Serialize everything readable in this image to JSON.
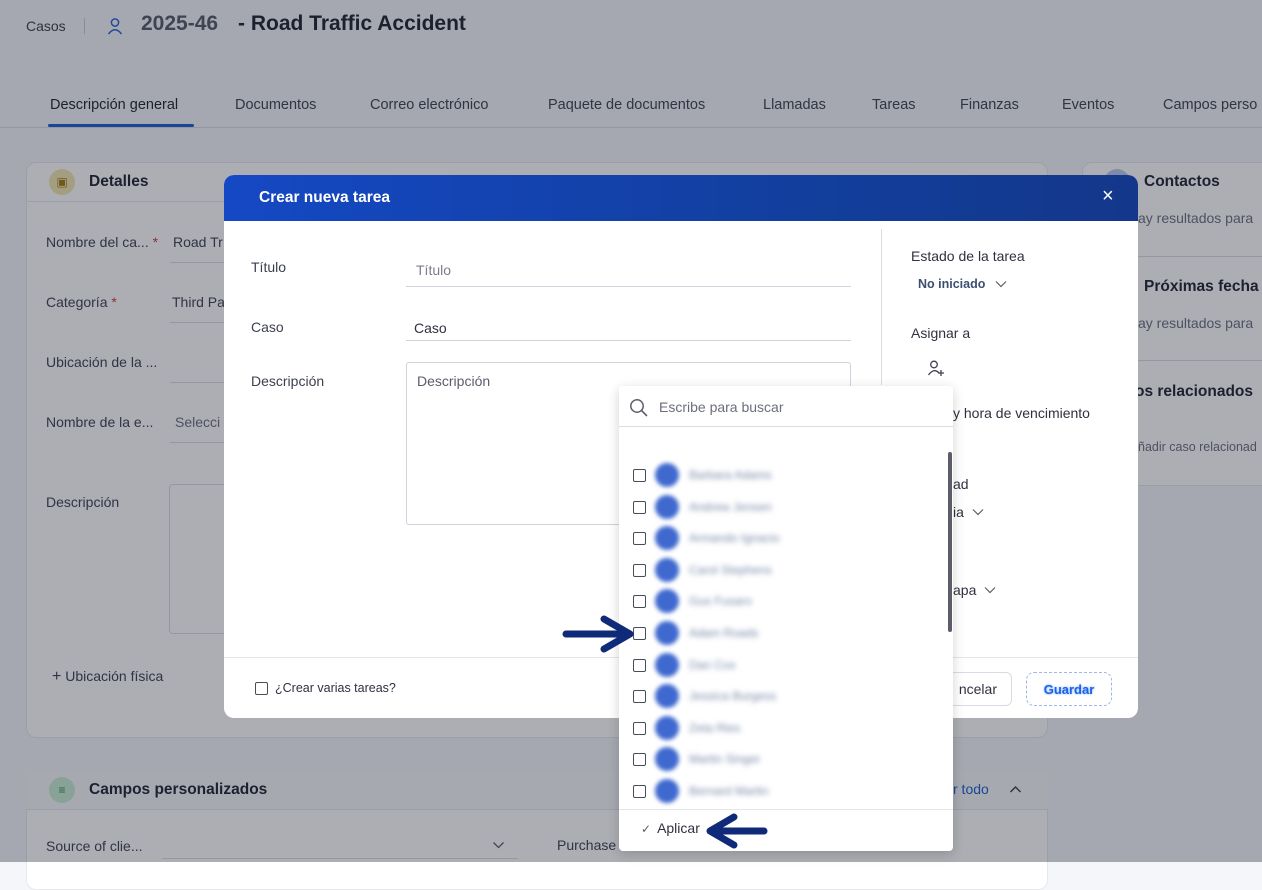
{
  "header": {
    "breadcrumb": "Casos",
    "case_number": "2025-46",
    "case_title": "- Road Traffic Accident"
  },
  "tabs": [
    {
      "label": "Descripción general",
      "active": true
    },
    {
      "label": "Documentos"
    },
    {
      "label": "Correo electrónico"
    },
    {
      "label": "Paquete de documentos"
    },
    {
      "label": "Llamadas"
    },
    {
      "label": "Tareas"
    },
    {
      "label": "Finanzas"
    },
    {
      "label": "Eventos"
    },
    {
      "label": "Campos perso"
    }
  ],
  "details": {
    "title": "Detalles",
    "fields": [
      {
        "label": "Nombre del ca...",
        "value": "Road Tr"
      },
      {
        "label": "Categoría",
        "value": "Third Pa"
      },
      {
        "label": "Ubicación de la ...",
        "value": ""
      },
      {
        "label": "Nombre de la e...",
        "value": "Selecci"
      },
      {
        "label": "Descripción",
        "value": ""
      }
    ],
    "physical_location": "Ubicación física"
  },
  "right_panel": {
    "contacts_title": "Contactos",
    "contacts_empty": "ay resultados para",
    "upcoming_title": "Próximas fecha",
    "upcoming_empty": "ay resultados para",
    "related_title": "os relacionados",
    "related_add": "ñadir caso relacionad"
  },
  "custom_fields": {
    "title": "Campos personalizados",
    "toggle_all": "r todo",
    "source_label": "Source of clie...",
    "purchase_label": "Purchase"
  },
  "modal": {
    "title": "Crear nueva tarea",
    "close": "×",
    "title_label": "Título",
    "title_placeholder": "Título",
    "case_label": "Caso",
    "case_value": "Caso",
    "description_label": "Descripción",
    "description_placeholder": "Descripción",
    "status_label": "Estado de la tarea",
    "status_value": "No iniciado",
    "assign_label": "Asignar a",
    "due_label": "y hora de vencimiento",
    "priority_label": "ad",
    "priority_value": "ia",
    "stage_value": "apa",
    "multi_tasks_label": "¿Crear varias tareas?",
    "cancel_label": "ncelar",
    "save_label": "Guardar"
  },
  "assign_dropdown": {
    "search_placeholder": "Escribe para buscar",
    "users": [
      "Barbara Adams",
      "Andrew Jensen",
      "Armando Ignacio",
      "Carol Stephens",
      "Gus Fusaro",
      "Adam Roads",
      "Dan Cox",
      "Jessica Burgess",
      "Zeta Ries",
      "Martin Singer",
      "Bernard Martin"
    ],
    "apply_label": "Aplicar"
  },
  "colors": {
    "modal_header": "#1548c4",
    "tab_accent": "#1a5fd0",
    "arrow": "#0f2a78"
  }
}
